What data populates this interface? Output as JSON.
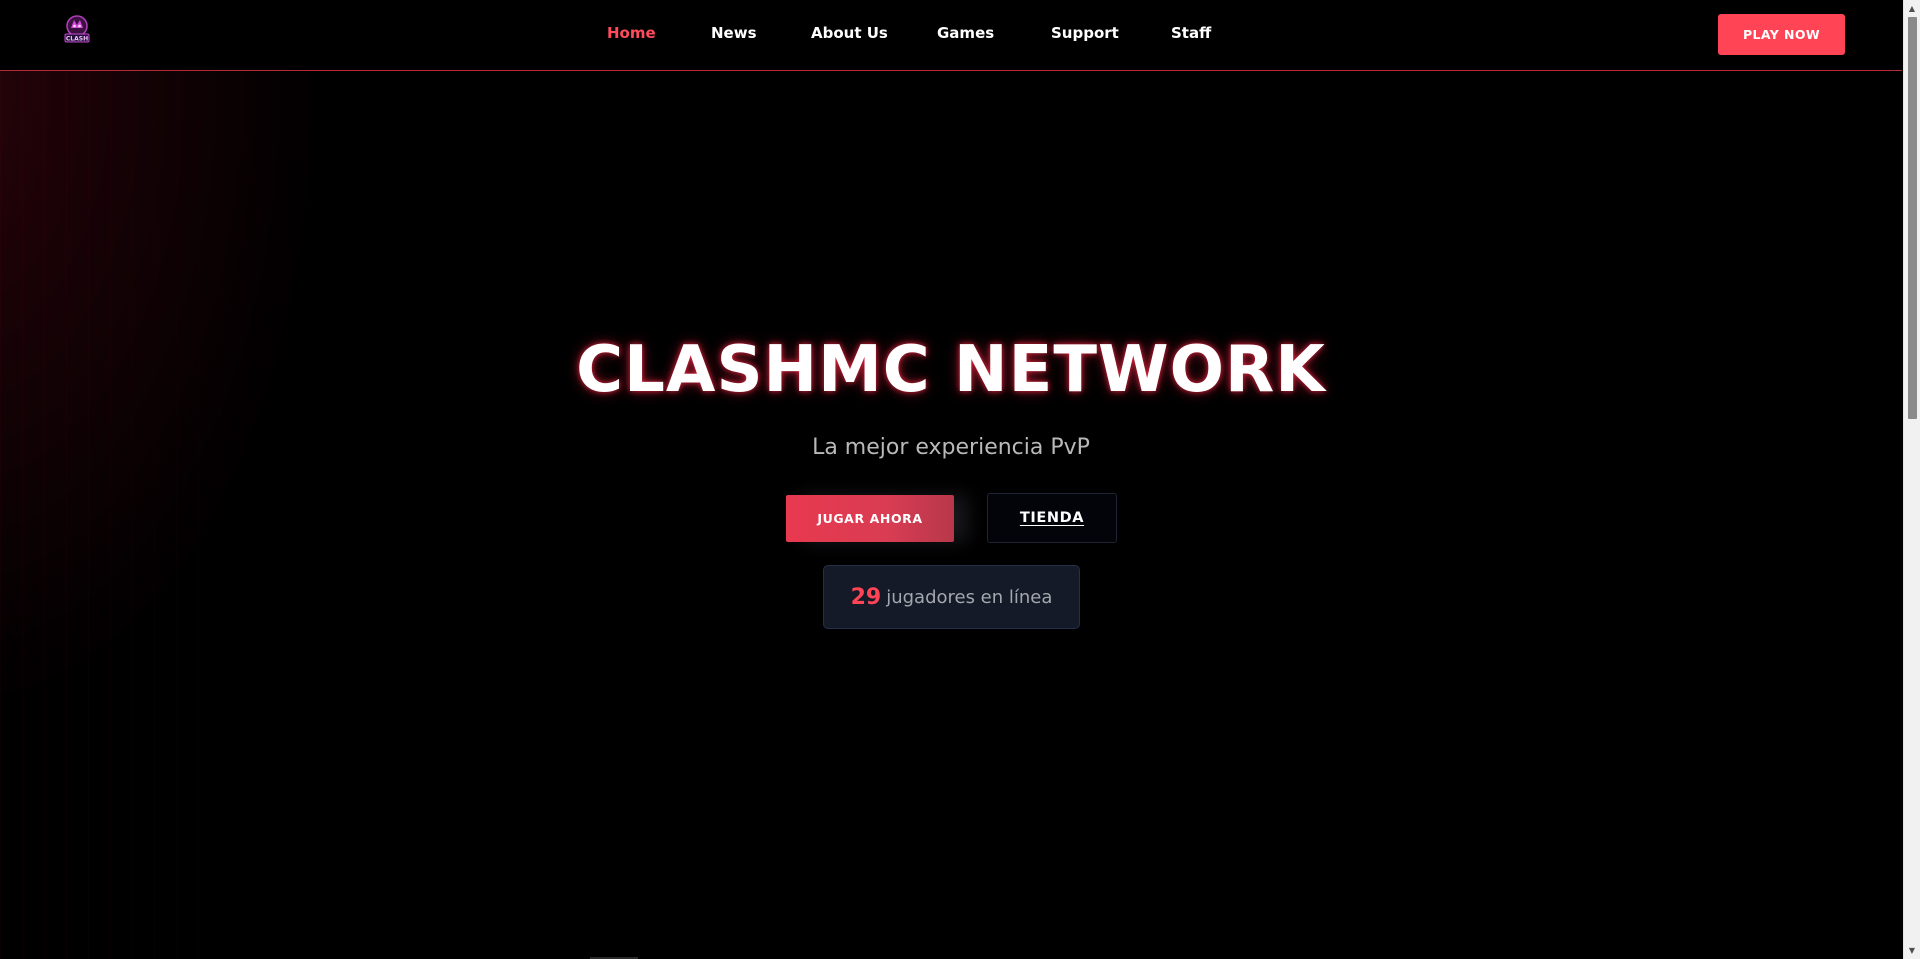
{
  "header": {
    "logo_text": "CLASH",
    "nav": [
      {
        "label": "Home",
        "active": true
      },
      {
        "label": "News",
        "active": false
      },
      {
        "label": "About Us",
        "active": false
      },
      {
        "label": "Games",
        "active": false
      },
      {
        "label": "Support",
        "active": false
      },
      {
        "label": "Staff",
        "active": false
      }
    ],
    "play_now_label": "PLAY NOW"
  },
  "hero": {
    "title": "CLASHMC NETWORK",
    "subtitle": "La mejor experiencia PvP",
    "primary_button": "JUGAR AHORA",
    "secondary_button": "TIENDA",
    "players": {
      "count": "29",
      "label": "jugadores en línea"
    }
  },
  "scrollbar": {
    "up_icon": "scroll-up-arrow-icon",
    "down_icon": "scroll-down-arrow-icon"
  },
  "colors": {
    "accent": "#ff4456",
    "active_nav": "#ff4b5c",
    "background": "#000000",
    "header_border": "#b4283a",
    "players_box": "#141a27",
    "subtitle": "#b9b9b9"
  }
}
